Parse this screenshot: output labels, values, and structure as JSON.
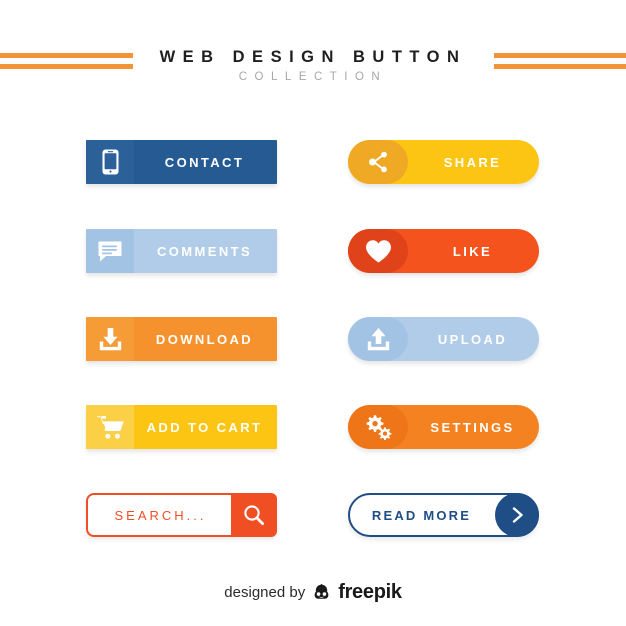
{
  "header": {
    "title": "WEB DESIGN BUTTON",
    "subtitle": "COLLECTION",
    "rule_color": "#f29339",
    "title_color": "#1f1f1f",
    "subtitle_color": "#a7a7a7"
  },
  "buttons": [
    {
      "id": "contact",
      "label": "CONTACT",
      "icon": "mobile-phone-icon",
      "shape": "rectangle",
      "bg_color": "#255a93",
      "icon_bg_color": "#2b6099",
      "text_color": "#ffffff",
      "column": "left",
      "row": 0
    },
    {
      "id": "share",
      "label": "SHARE",
      "icon": "share-nodes-icon",
      "shape": "pill",
      "bg_color": "#fdc513",
      "icon_bg_color": "#f0a924",
      "text_color": "#ffffff",
      "column": "right",
      "row": 0
    },
    {
      "id": "comments",
      "label": "COMMENTS",
      "icon": "speech-bubble-icon",
      "shape": "rectangle",
      "bg_color": "#b0cce8",
      "icon_bg_color": "#a2c3e3",
      "text_color": "#ffffff",
      "column": "left",
      "row": 1
    },
    {
      "id": "like",
      "label": "LIKE",
      "icon": "heart-icon",
      "shape": "pill",
      "bg_color": "#f4531d",
      "icon_bg_color": "#e0431a",
      "text_color": "#ffffff",
      "column": "right",
      "row": 1
    },
    {
      "id": "download",
      "label": "DOWNLOAD",
      "icon": "download-arrow-icon",
      "shape": "rectangle",
      "bg_color": "#f6922d",
      "icon_bg_color": "#f59c37",
      "text_color": "#ffffff",
      "column": "left",
      "row": 2
    },
    {
      "id": "upload",
      "label": "UPLOAD",
      "icon": "upload-arrow-icon",
      "shape": "pill",
      "bg_color": "#b0cce8",
      "icon_bg_color": "#a2c3e3",
      "text_color": "#ffffff",
      "column": "right",
      "row": 2
    },
    {
      "id": "add-to-cart",
      "label": "ADD TO CART",
      "icon": "shopping-cart-icon",
      "shape": "rectangle",
      "bg_color": "#fdc513",
      "icon_bg_color": "#fbcf46",
      "text_color": "#ffffff",
      "column": "left",
      "row": 3
    },
    {
      "id": "settings",
      "label": "SETTINGS",
      "icon": "gears-icon",
      "shape": "pill",
      "bg_color": "#f58220",
      "icon_bg_color": "#ee7518",
      "text_color": "#ffffff",
      "column": "right",
      "row": 3
    }
  ],
  "search": {
    "value": "SEARCH...",
    "placeholder": "SEARCH...",
    "icon": "magnifier-icon",
    "accent_color": "#f04e23",
    "text_color": "#f04e23",
    "column": "left",
    "row": 4
  },
  "read_more": {
    "label": "READ MORE",
    "icon": "chevron-right-icon",
    "accent_color": "#1f4e87",
    "text_color": "#1f4e87",
    "column": "right",
    "row": 4
  },
  "footer": {
    "designed_by": "designed by",
    "brand": "freepik",
    "logo_icon": "freepik-face-icon"
  }
}
